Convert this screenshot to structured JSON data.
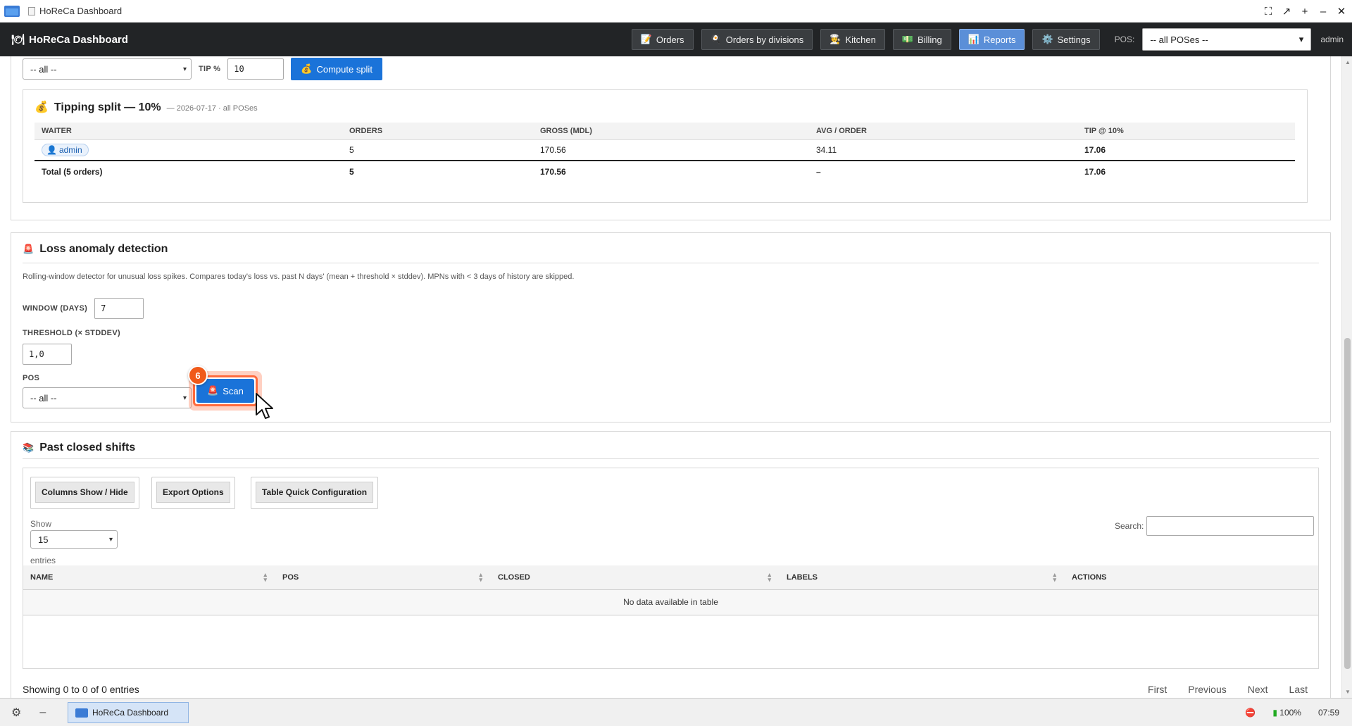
{
  "window": {
    "title": "HoReCa Dashboard",
    "controls": [
      "⛶",
      "↗",
      "+",
      "–",
      "✕"
    ]
  },
  "navbar": {
    "brand": "HoReCa Dashboard",
    "items": [
      {
        "label": "Orders",
        "icon": "📝",
        "active": false
      },
      {
        "label": "Orders by divisions",
        "icon": "🍳",
        "active": false
      },
      {
        "label": "Kitchen",
        "icon": "🧑‍🍳",
        "active": false
      },
      {
        "label": "Billing",
        "icon": "💵",
        "active": false
      },
      {
        "label": "Reports",
        "icon": "📊",
        "active": true
      },
      {
        "label": "Settings",
        "icon": "⚙️",
        "active": false
      }
    ],
    "pos_label": "POS:",
    "pos_value": "-- all POSes --",
    "user": "admin"
  },
  "tipping": {
    "top_select": "-- all --",
    "tip_label": "TIP %",
    "tip_value": "10",
    "compute_label": "Compute split",
    "title": "Tipping split — 10%",
    "meta": "— 2026-07-17 · all POSes",
    "columns": [
      "WAITER",
      "ORDERS",
      "GROSS (MDL)",
      "AVG / ORDER",
      "TIP @ 10%"
    ],
    "rows": [
      {
        "waiter": "admin",
        "orders": "5",
        "gross": "170.56",
        "avg": "34.11",
        "tip": "17.06"
      }
    ],
    "total": {
      "label": "Total (5 orders)",
      "orders": "5",
      "gross": "170.56",
      "avg": "–",
      "tip": "17.06"
    }
  },
  "loss": {
    "title": "Loss anomaly detection",
    "description": "Rolling-window detector for unusual loss spikes. Compares today's loss vs. past N days' (mean + threshold × stddev). MPNs with < 3 days of history are skipped.",
    "window_label": "WINDOW (DAYS)",
    "window_value": "7",
    "threshold_label": "THRESHOLD (× STDDEV)",
    "threshold_value": "1,0",
    "pos_label": "POS",
    "pos_value": "-- all --",
    "scan_label": "Scan",
    "step_number": "6"
  },
  "shifts": {
    "title": "Past closed shifts",
    "tool_buttons": [
      "Columns Show / Hide",
      "Export Options",
      "Table Quick Configuration"
    ],
    "show_label": "Show",
    "page_size": "15",
    "entries_label": "entries",
    "search_label": "Search:",
    "columns": [
      "NAME",
      "POS",
      "CLOSED",
      "LABELS",
      "ACTIONS"
    ],
    "empty_text": "No data available in table",
    "info": "Showing 0 to 0 of 0 entries",
    "pager": [
      "First",
      "Previous",
      "Next",
      "Last"
    ]
  },
  "taskbar": {
    "task_label": "HoReCa Dashboard",
    "battery": "100%",
    "time": "07:59"
  }
}
